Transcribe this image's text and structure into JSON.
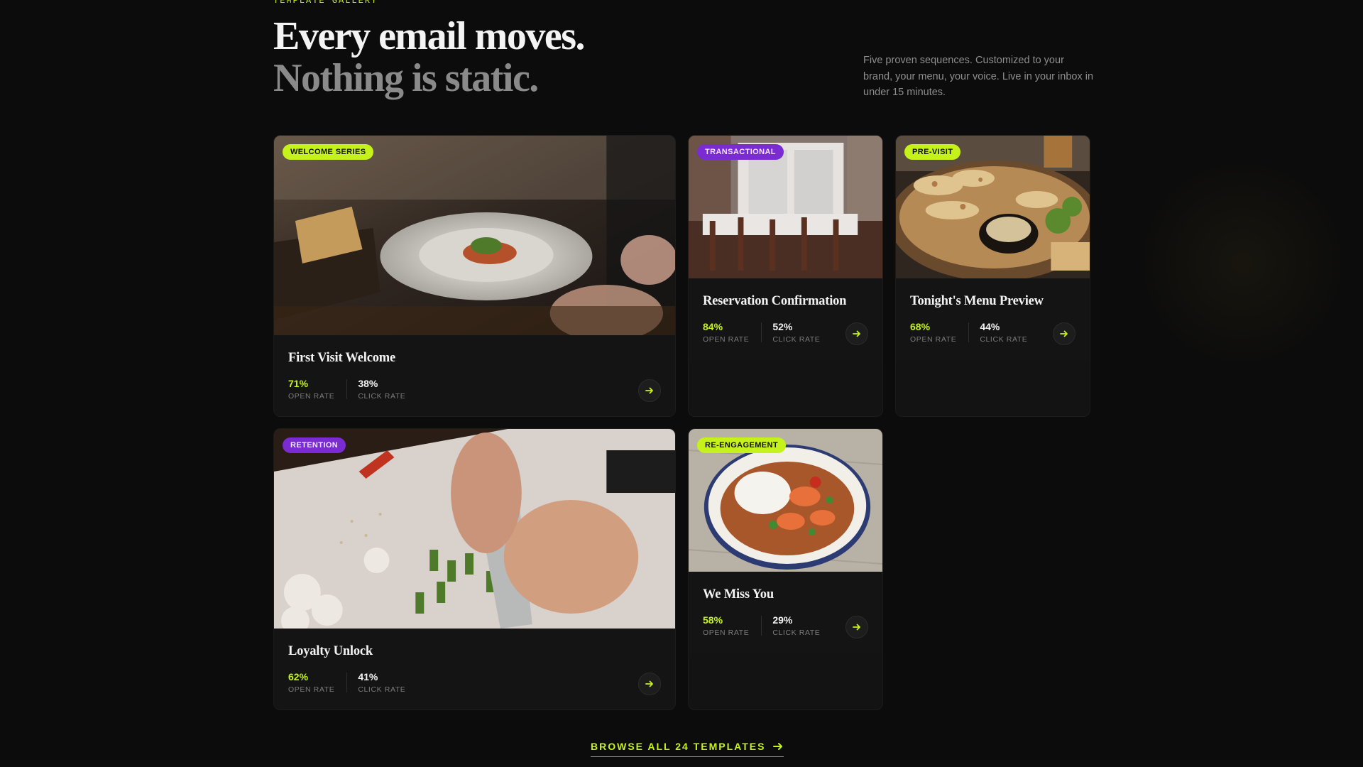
{
  "header": {
    "eyebrow": "TEMPLATE GALLERY",
    "headline_line1": "Every email moves.",
    "headline_line2": "Nothing is static.",
    "description": "Five proven sequences. Customized to your brand, your menu, your voice. Live in your inbox in under 15 minutes."
  },
  "cards": [
    {
      "badge": "WELCOME SERIES",
      "badge_color": "#c6f21c",
      "title": "First Visit Welcome",
      "open_value": "71%",
      "open_label": "OPEN RATE",
      "click_value": "38%",
      "click_label": "CLICK RATE",
      "image": "plated-dish-dining-table"
    },
    {
      "badge": "TRANSACTIONAL",
      "badge_color": "#7a2bd1",
      "title": "Reservation Confirmation",
      "open_value": "84%",
      "open_label": "OPEN RATE",
      "click_value": "52%",
      "click_label": "CLICK RATE",
      "image": "empty-restaurant-interior"
    },
    {
      "badge": "PRE-VISIT",
      "badge_color": "#c6f21c",
      "title": "Tonight's Menu Preview",
      "open_value": "68%",
      "open_label": "OPEN RATE",
      "click_value": "44%",
      "click_label": "CLICK RATE",
      "image": "grilled-platter-with-dip"
    },
    {
      "badge": "RETENTION",
      "badge_color": "#7a2bd1",
      "title": "Loyalty Unlock",
      "open_value": "62%",
      "open_label": "OPEN RATE",
      "click_value": "41%",
      "click_label": "CLICK RATE",
      "image": "chef-chopping-vegetables"
    },
    {
      "badge": "RE-ENGAGEMENT",
      "badge_color": "#c6f21c",
      "title": "We Miss You",
      "open_value": "58%",
      "open_label": "OPEN RATE",
      "click_value": "29%",
      "click_label": "CLICK RATE",
      "image": "shrimp-curry-bowl"
    }
  ],
  "cta": {
    "label": "BROWSE ALL 24 TEMPLATES",
    "icon": "arrow-right-icon"
  }
}
